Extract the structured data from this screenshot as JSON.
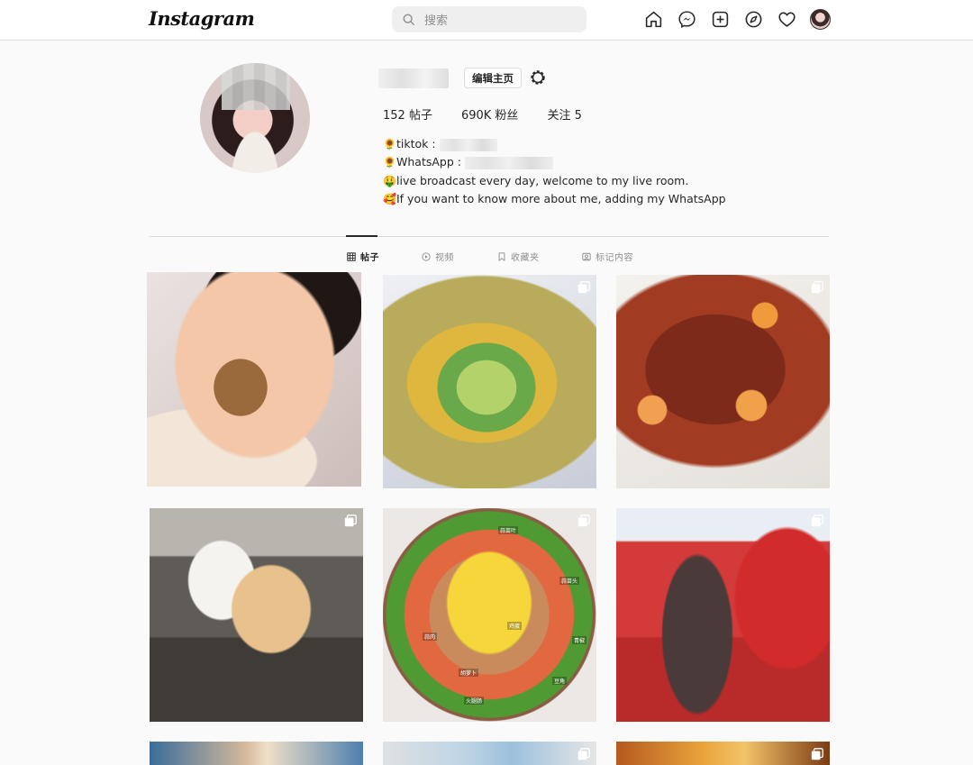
{
  "header": {
    "logo": "Instagram",
    "search_placeholder": "搜索",
    "nav_icons": [
      "home-icon",
      "messenger-icon",
      "new-post-icon",
      "explore-icon",
      "heart-icon",
      "profile-avatar"
    ]
  },
  "profile": {
    "edit_button": "编辑主页",
    "stats": {
      "posts": "152 帖子",
      "followers": "690K 粉丝",
      "following": "关注 5"
    },
    "bio": [
      {
        "emoji": "🌻",
        "text": "tiktok :"
      },
      {
        "emoji": "🌻",
        "text": "WhatsApp :"
      },
      {
        "emoji": "🤑",
        "text": "live broadcast every day, welcome to my live room."
      },
      {
        "emoji": "🥰",
        "text": "If you want to know more about me, adding my WhatsApp"
      }
    ]
  },
  "tabs": [
    {
      "label": "帖子",
      "icon": "grid-icon",
      "active": true
    },
    {
      "label": "视频",
      "icon": "play-icon",
      "active": false
    },
    {
      "label": "收藏夹",
      "icon": "bookmark-icon",
      "active": false
    },
    {
      "label": "标记内容",
      "icon": "tag-icon",
      "active": false
    }
  ],
  "posts": [
    {
      "subject": "baby-eating",
      "multi": false
    },
    {
      "subject": "egg-pancake",
      "multi": true
    },
    {
      "subject": "braised-pork",
      "multi": true
    },
    {
      "subject": "dogs",
      "multi": true
    },
    {
      "subject": "chopped-vegetables-plate",
      "multi": true,
      "labels": [
        "蒜苗叶",
        "蒜苗头",
        "鸡蛋",
        "青椒",
        "蒜肉",
        "胡萝卜",
        "火腿肠",
        "豆角"
      ]
    },
    {
      "subject": "market-shopping",
      "multi": true
    },
    {
      "subject": "partial-1",
      "multi": false
    },
    {
      "subject": "partial-2",
      "multi": true
    },
    {
      "subject": "partial-3",
      "multi": true
    }
  ],
  "colors": {
    "accent": "#262626",
    "border": "#dbdbdb",
    "muted": "#8e8e8e",
    "background": "#fafafa"
  }
}
